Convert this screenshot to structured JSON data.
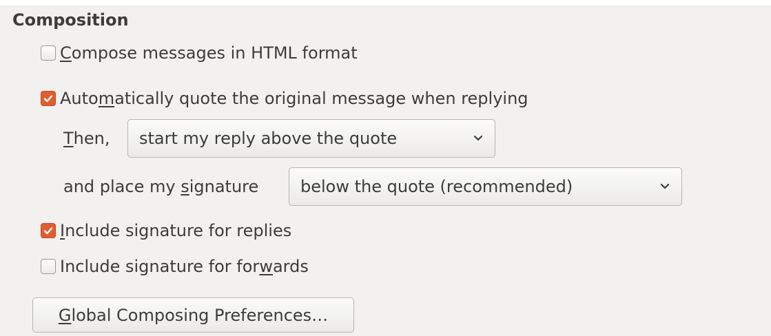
{
  "section": {
    "title": "Composition"
  },
  "options": {
    "compose_html": {
      "accel": "C",
      "rest": "ompose messages in HTML format",
      "checked": false
    },
    "auto_quote": {
      "pre": "Auto",
      "accel": "m",
      "rest": "atically quote the original message when replying",
      "checked": true
    },
    "include_sig_replies": {
      "accel": "I",
      "rest": "nclude signature for replies",
      "checked": true
    },
    "include_sig_forwards": {
      "pre": "Include signature for for",
      "accel": "w",
      "rest": "ards",
      "checked": false
    }
  },
  "reply_position": {
    "label_accel": "T",
    "label_rest": "hen,",
    "selected": "start my reply above the quote"
  },
  "signature_position": {
    "label_pre": "and place my ",
    "label_accel": "s",
    "label_rest": "ignature",
    "selected": "below the quote (recommended)"
  },
  "global_button": {
    "accel": "G",
    "rest": "lobal Composing Preferences…"
  },
  "colors": {
    "check_accent": "#e05e2f",
    "background": "#f2f1f0"
  },
  "icons": {
    "check": "checkmark-icon",
    "dropdown": "chevron-down-icon"
  }
}
